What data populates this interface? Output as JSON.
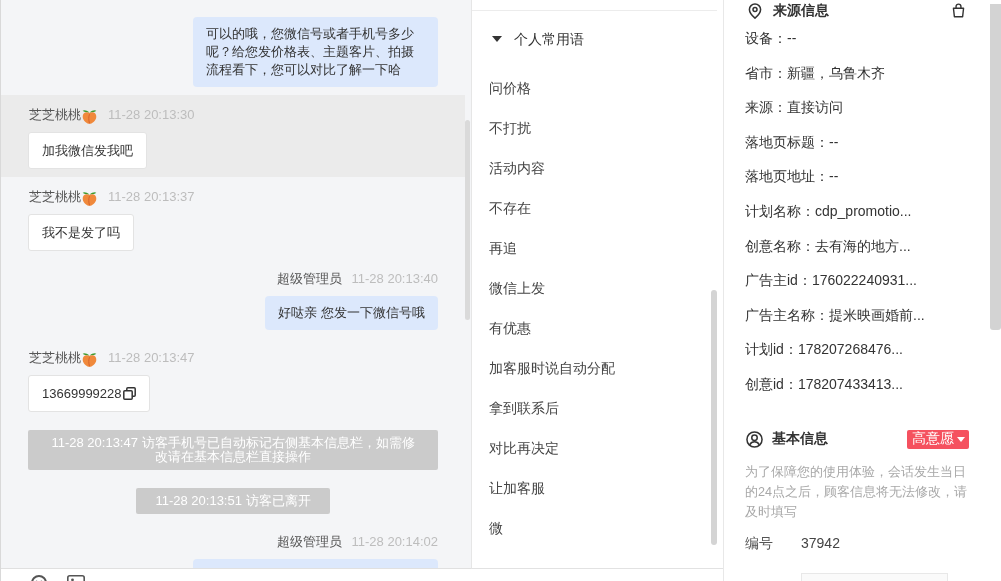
{
  "chat": {
    "messages": [
      {
        "kind": "agent",
        "highlighted": false,
        "text": "可以的哦，您微信号或者手机号多少呢？给您发价格表、主题客片、拍摄流程看下，您可以对比了解一下哈"
      },
      {
        "kind": "visitor",
        "highlighted": true,
        "name": "芝芝桃桃",
        "name_icon": true,
        "time": "11-28 20:13:30",
        "text": "加我微信发我吧",
        "copy_icon": false
      },
      {
        "kind": "visitor",
        "highlighted": false,
        "name": "芝芝桃桃",
        "name_icon": true,
        "time": "11-28 20:13:37",
        "text": "我不是发了吗",
        "copy_icon": false
      },
      {
        "kind": "agent",
        "highlighted": false,
        "name": "超级管理员",
        "time": "11-28 20:13:40",
        "text": "好哒亲 您发一下微信号哦"
      },
      {
        "kind": "visitor",
        "highlighted": false,
        "name": "芝芝桃桃",
        "name_icon": true,
        "time": "11-28 20:13:47",
        "text": "13669999228",
        "copy_icon": true
      },
      {
        "kind": "system",
        "highlighted": false,
        "text": "11-28 20:13:47 访客手机号已自动标记右侧基本信息栏，如需修改请在基本信息栏直接操作"
      },
      {
        "kind": "system",
        "highlighted": false,
        "text": "11-28 20:13:51 访客已离开"
      },
      {
        "kind": "agent",
        "highlighted": false,
        "name": "超级管理员",
        "time": "11-28 20:14:02"
      }
    ]
  },
  "phrases": {
    "group": "个人常用语",
    "expanded": true,
    "items": [
      "问价格",
      "不打扰",
      "活动内容",
      "不存在",
      "再追",
      "微信上发",
      "有优惠",
      "加客服时说自动分配",
      "拿到联系后",
      "对比再决定",
      "让加客服",
      "微"
    ]
  },
  "source_info": {
    "title": "来源信息",
    "rows": [
      "设备：--",
      "省市：新疆，乌鲁木齐",
      "来源：直接访问",
      "落地页标题：--",
      "落地页地址：--",
      "计划名称：cdp_promotio...",
      "创意名称：去有海的地方...",
      "广告主id：176022240931...",
      "广告主名称：提米映画婚前...",
      "计划id：178207268476...",
      "创意id：178207433413..."
    ]
  },
  "basic_info": {
    "title": "基本信息",
    "intent_tag": "高意愿",
    "notice": "为了保障您的使用体验，会话发生当日的24点之后，顾客信息将无法修改，请及时填写",
    "fields": [
      {
        "kind": "text",
        "label": "编号",
        "value": "37942"
      },
      {
        "kind": "input"
      }
    ]
  }
}
